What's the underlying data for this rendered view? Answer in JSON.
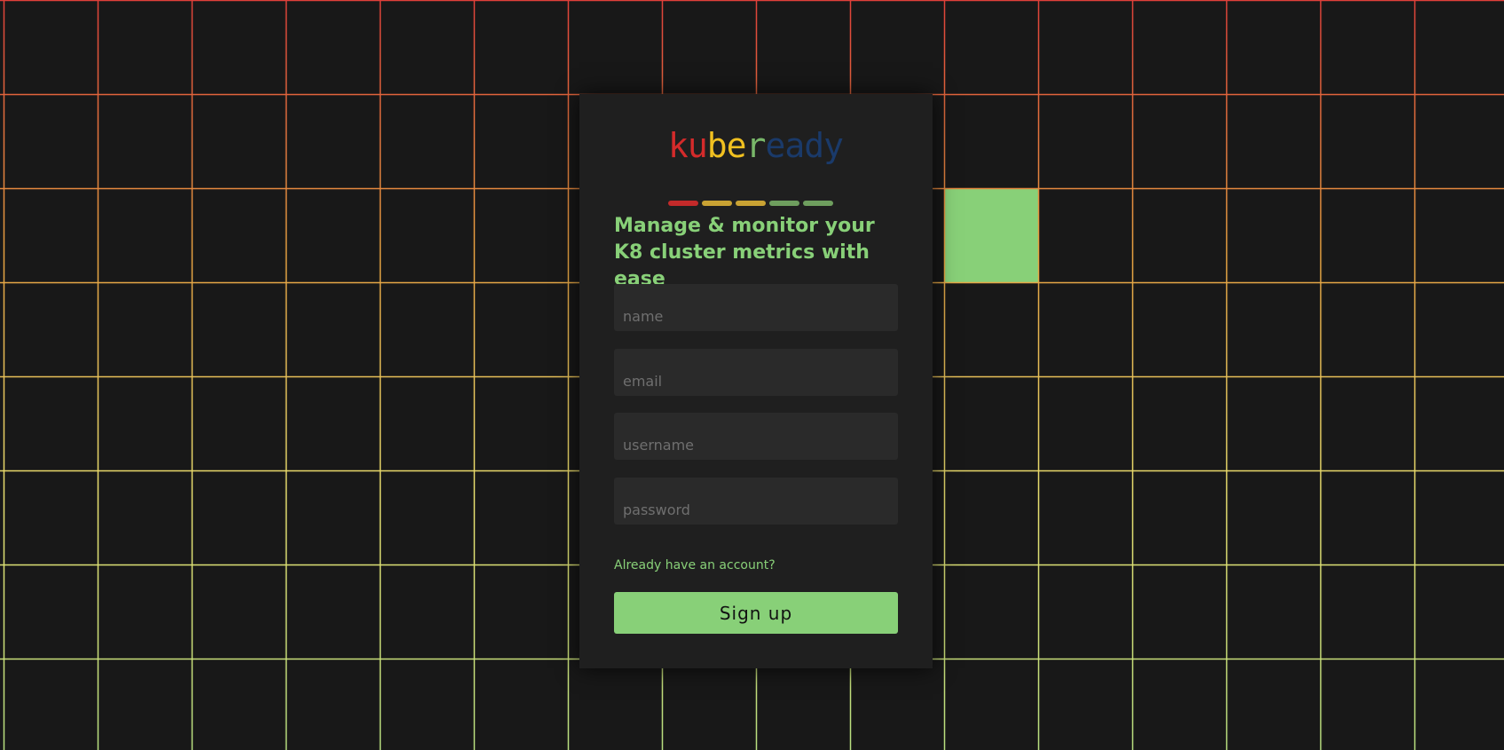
{
  "logo": {
    "letters": [
      {
        "char": "k",
        "color": "#d42b2b"
      },
      {
        "char": "u",
        "color": "#d42b2b"
      },
      {
        "char": "b",
        "color": "#f0c020"
      },
      {
        "char": "e",
        "color": "#f0c020"
      },
      {
        "char": "r",
        "color": "#79b86a"
      },
      {
        "char": "e",
        "color": "#1a3a6a"
      },
      {
        "char": "a",
        "color": "#1a3a6a"
      },
      {
        "char": "d",
        "color": "#1a3a6a"
      },
      {
        "char": "y",
        "color": "#1a3a6a"
      }
    ],
    "bar_colors": [
      "#c42a2a",
      "#c9a233",
      "#c9a233",
      "#6e9e5e",
      "#6e9e5e"
    ]
  },
  "headline": "Manage & monitor your K8 cluster metrics with ease",
  "form": {
    "name_placeholder": "name",
    "email_placeholder": "email",
    "username_placeholder": "username",
    "password_placeholder": "password",
    "login_link": "Already have an account?",
    "submit_label": "Sign up"
  },
  "background": {
    "base_color": "#181818",
    "line_gradient_colors": [
      "#e0403a",
      "#e6a040",
      "#e8e070",
      "#b8e080"
    ],
    "highlight_color": "#88d078"
  }
}
